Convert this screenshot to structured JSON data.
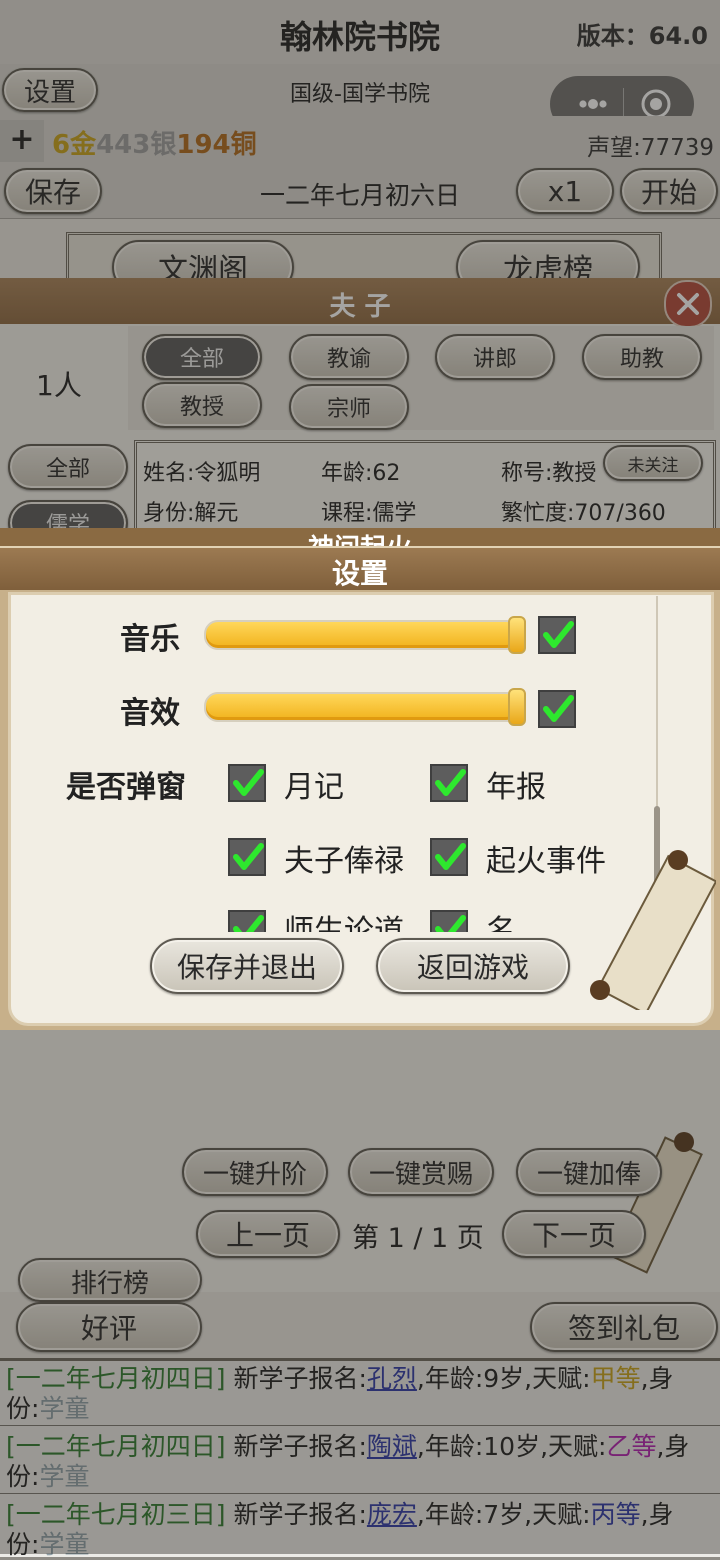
{
  "header": {
    "title": "翰林院书院",
    "version": "版本：64.0",
    "settings_label": "设置",
    "rank": "国级-国学书院",
    "currency_plus": "+",
    "gold": "6金",
    "silver": "443银",
    "copper": "194铜",
    "reputation": "声望:77739",
    "save_label": "保存",
    "date": "一二年七月初六日",
    "speed_label": "x1",
    "start_label": "开始"
  },
  "capsule": {
    "more_icon": "more-dots-icon",
    "close_icon": "target-circle-icon"
  },
  "buildings": {
    "left_label": "文渊阁",
    "right_label": "龙虎榜"
  },
  "teacher_panel": {
    "title": "夫 子",
    "count": "1人",
    "rank_tabs": [
      "全部",
      "教谕",
      "讲郎",
      "助教",
      "教授",
      "宗师"
    ],
    "side_tabs": [
      "全部",
      "儒学"
    ],
    "card": {
      "name": "姓名:令狐明",
      "age": "年龄:62",
      "title": "称号:教授",
      "follow_label": "未关注",
      "identity": "身份:解元",
      "course": "课程:儒学",
      "busy": "繁忙度:707/360"
    },
    "hidden_header": "神间起火",
    "actions": [
      "一键升阶",
      "一键赏赐",
      "一键加俸"
    ],
    "prev_label": "上一页",
    "page_info": "第 1 / 1 页",
    "next_label": "下一页"
  },
  "bottom_buttons": {
    "rank_label": "排行榜",
    "rate_label": "好评",
    "gift_label": "签到礼包"
  },
  "settings_dialog": {
    "title": "设置",
    "music_label": "音乐",
    "music_level": 1.0,
    "music_enabled": true,
    "sfx_label": "音效",
    "sfx_level": 1.0,
    "sfx_enabled": true,
    "popup_label": "是否弹窗",
    "popup_options": [
      {
        "label": "月记",
        "checked": true
      },
      {
        "label": "年报",
        "checked": true
      },
      {
        "label": "夫子俸禄",
        "checked": true
      },
      {
        "label": "起火事件",
        "checked": true
      },
      {
        "label": "师生论道",
        "checked": true
      },
      {
        "label": "名institution资助",
        "checked": true
      }
    ],
    "save_exit_label": "保存并退出",
    "back_label": "返回游戏"
  },
  "log": [
    {
      "date": "[一二年七月初四日]",
      "text": " 新学子报名:",
      "name": "孔烈",
      "age": ",年龄:9岁,天赋:",
      "grade": "甲等",
      "grade_color": "#c9a21a",
      "tail": ",身",
      "line2a": "份:",
      "line2b": "学童"
    },
    {
      "date": "[一二年七月初四日]",
      "text": " 新学子报名:",
      "name": "陶斌",
      "age": ",年龄:10岁,天赋:",
      "grade": "乙等",
      "grade_color": "#b21fb0",
      "tail": ",身",
      "line2a": "份:",
      "line2b": "学童"
    },
    {
      "date": "[一二年七月初三日]",
      "text": " 新学子报名:",
      "name": "庞宏",
      "age": ",年龄:7岁,天赋:",
      "grade": "丙等",
      "grade_color": "#2f3aa8",
      "tail": ",身",
      "line2a": "份:",
      "line2b": "学童"
    }
  ],
  "colors": {
    "accent_dialog": "#8a6a42",
    "gold": "#c9a21a",
    "check": "#2ee82e"
  }
}
